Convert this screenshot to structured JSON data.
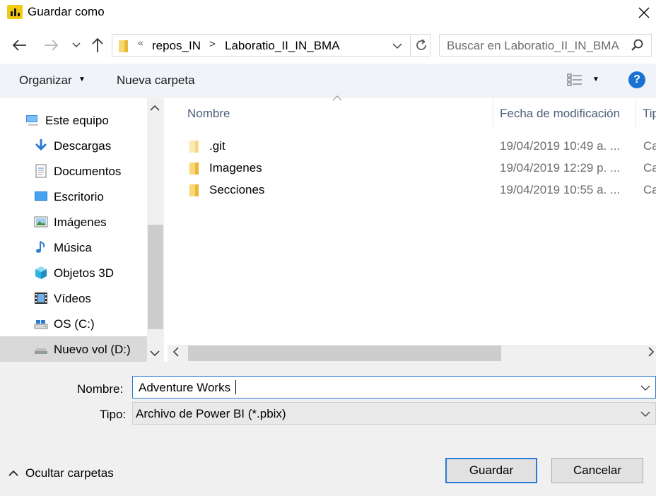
{
  "window": {
    "title": "Guardar como",
    "icon": "power-bi-icon",
    "close_icon": "close-icon"
  },
  "address": {
    "prefix": "«",
    "crumbs": [
      "repos_IN",
      "Laboratio_II_IN_BMA"
    ],
    "separator": ">"
  },
  "search": {
    "placeholder": "Buscar en Laboratio_II_IN_BMA"
  },
  "toolbar": {
    "organize_label": "Organizar",
    "new_folder_label": "Nueva carpeta",
    "help_label": "?"
  },
  "sidebar": {
    "items": [
      {
        "label": "Este equipo",
        "icon": "computer-icon"
      },
      {
        "label": "Descargas",
        "icon": "downloads-icon"
      },
      {
        "label": "Documentos",
        "icon": "documents-icon"
      },
      {
        "label": "Escritorio",
        "icon": "desktop-icon"
      },
      {
        "label": "Imágenes",
        "icon": "pictures-icon"
      },
      {
        "label": "Música",
        "icon": "music-icon"
      },
      {
        "label": "Objetos 3D",
        "icon": "3d-objects-icon"
      },
      {
        "label": "Vídeos",
        "icon": "videos-icon"
      },
      {
        "label": "OS (C:)",
        "icon": "drive-icon"
      },
      {
        "label": "Nuevo vol (D:)",
        "icon": "drive-icon",
        "selected": true
      }
    ]
  },
  "filelist": {
    "columns": [
      "Nombre",
      "Fecha de modificación",
      "Tip"
    ],
    "rows": [
      {
        "name": ".git",
        "date": "19/04/2019 10:49 a. ...",
        "type": "Ca"
      },
      {
        "name": "Imagenes",
        "date": "19/04/2019 12:29 p. ...",
        "type": "Ca"
      },
      {
        "name": "Secciones",
        "date": "19/04/2019 10:55 a. ...",
        "type": "Ca"
      }
    ]
  },
  "form": {
    "name_label": "Nombre:",
    "name_value": "Adventure Works",
    "type_label": "Tipo:",
    "type_value": "Archivo de Power BI (*.pbix)"
  },
  "footer": {
    "hide_folders_label": "Ocultar carpetas",
    "save_label": "Guardar",
    "cancel_label": "Cancelar"
  },
  "colors": {
    "accent": "#2b79d8",
    "toolbar_bg": "#f0f4f9",
    "selected_nav": "#d9d9d9",
    "folder": "#f8d775"
  }
}
